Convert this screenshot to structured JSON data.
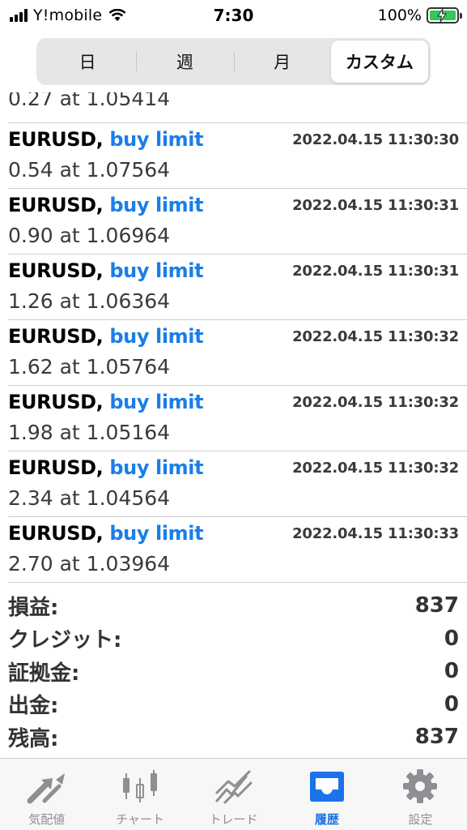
{
  "status_bar": {
    "carrier": "Y!mobile",
    "time": "7:30",
    "battery_percent": "100%"
  },
  "segments": [
    {
      "label": "日",
      "active": false
    },
    {
      "label": "週",
      "active": false
    },
    {
      "label": "月",
      "active": false
    },
    {
      "label": "カスタム",
      "active": true
    }
  ],
  "partial_row": {
    "detail": "0.27 at 1.05414"
  },
  "orders": [
    {
      "symbol": "EURUSD,",
      "type": "buy limit",
      "time": "2022.04.15 11:30:30",
      "detail": "0.54 at 1.07564"
    },
    {
      "symbol": "EURUSD,",
      "type": "buy limit",
      "time": "2022.04.15 11:30:31",
      "detail": "0.90 at 1.06964"
    },
    {
      "symbol": "EURUSD,",
      "type": "buy limit",
      "time": "2022.04.15 11:30:31",
      "detail": "1.26 at 1.06364"
    },
    {
      "symbol": "EURUSD,",
      "type": "buy limit",
      "time": "2022.04.15 11:30:32",
      "detail": "1.62 at 1.05764"
    },
    {
      "symbol": "EURUSD,",
      "type": "buy limit",
      "time": "2022.04.15 11:30:32",
      "detail": "1.98 at 1.05164"
    },
    {
      "symbol": "EURUSD,",
      "type": "buy limit",
      "time": "2022.04.15 11:30:32",
      "detail": "2.34 at 1.04564"
    },
    {
      "symbol": "EURUSD,",
      "type": "buy limit",
      "time": "2022.04.15 11:30:33",
      "detail": "2.70 at 1.03964"
    }
  ],
  "summary": [
    {
      "label": "損益:",
      "value": "837"
    },
    {
      "label": "クレジット:",
      "value": "0"
    },
    {
      "label": "証拠金:",
      "value": "0"
    },
    {
      "label": "出金:",
      "value": "0"
    },
    {
      "label": "残高:",
      "value": "837"
    }
  ],
  "tabs": [
    {
      "label": "気配値",
      "icon": "quotes-arrows-icon",
      "active": false
    },
    {
      "label": "チャート",
      "icon": "candlestick-chart-icon",
      "active": false
    },
    {
      "label": "トレード",
      "icon": "trade-line-icon",
      "active": false
    },
    {
      "label": "履歴",
      "icon": "history-inbox-icon",
      "active": true
    },
    {
      "label": "設定",
      "icon": "gear-icon",
      "active": false
    }
  ],
  "colors": {
    "accent": "#1a7ee8",
    "inactive_icon": "#8e8e93",
    "battery_green": "#34c759"
  }
}
